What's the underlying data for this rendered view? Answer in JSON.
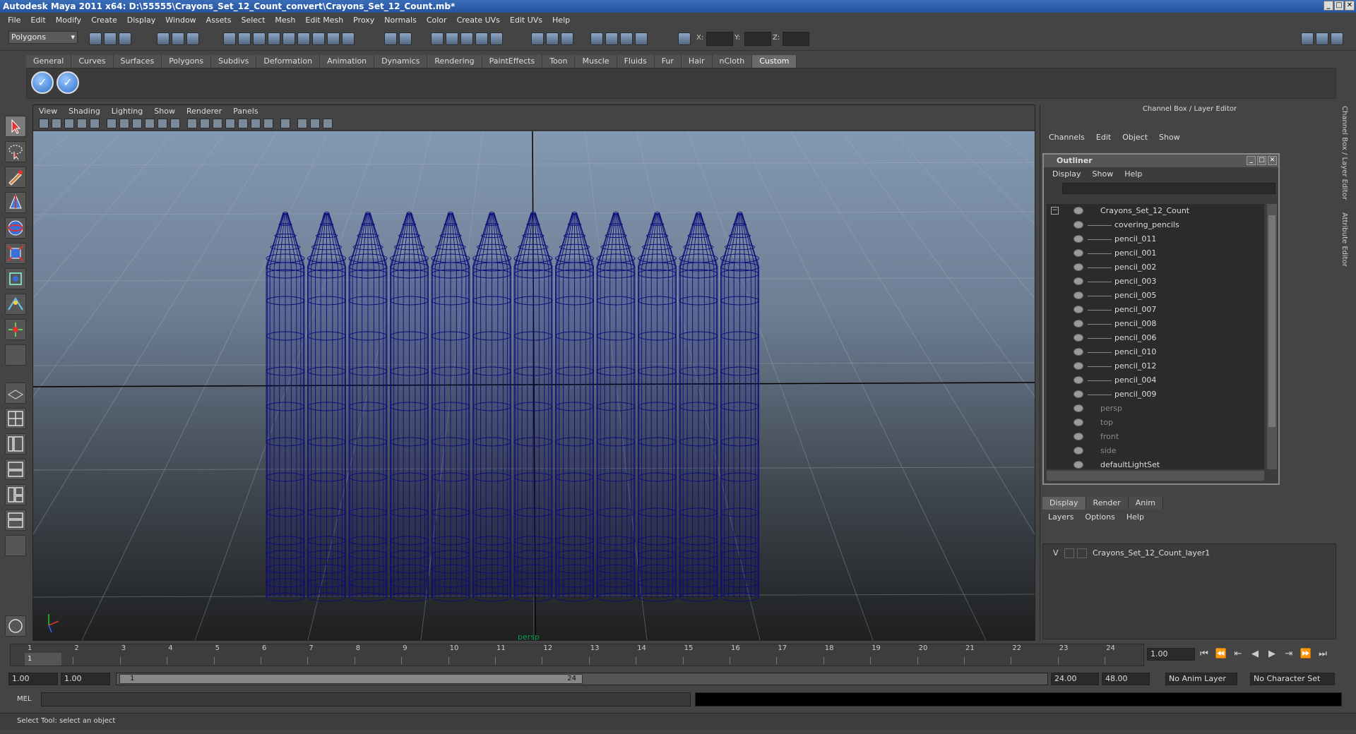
{
  "window": {
    "title": "Autodesk Maya 2011 x64: D:\\55555\\Crayons_Set_12_Count_convert\\Crayons_Set_12_Count.mb*"
  },
  "menubar": [
    "File",
    "Edit",
    "Modify",
    "Create",
    "Display",
    "Window",
    "Assets",
    "Select",
    "Mesh",
    "Edit Mesh",
    "Proxy",
    "Normals",
    "Color",
    "Create UVs",
    "Edit UVs",
    "Help"
  ],
  "statusline": {
    "mode": "Polygons",
    "x_label": "X:",
    "y_label": "Y:",
    "z_label": "Z:"
  },
  "shelf_tabs": [
    "General",
    "Curves",
    "Surfaces",
    "Polygons",
    "Subdivs",
    "Deformation",
    "Animation",
    "Dynamics",
    "Rendering",
    "PaintEffects",
    "Toon",
    "Muscle",
    "Fluids",
    "Fur",
    "Hair",
    "nCloth",
    "Custom"
  ],
  "shelf_active_tab": "Custom",
  "viewport": {
    "menu": [
      "View",
      "Shading",
      "Lighting",
      "Show",
      "Renderer",
      "Panels"
    ],
    "camera": "persp"
  },
  "channel_box": {
    "title": "Channel Box / Layer Editor",
    "menu": [
      "Channels",
      "Edit",
      "Object",
      "Show"
    ]
  },
  "outliner": {
    "title": "Outliner",
    "menu": [
      "Display",
      "Show",
      "Help"
    ],
    "root": "Crayons_Set_12_Count",
    "children": [
      "covering_pencils",
      "pencil_011",
      "pencil_001",
      "pencil_002",
      "pencil_003",
      "pencil_005",
      "pencil_007",
      "pencil_008",
      "pencil_006",
      "pencil_010",
      "pencil_012",
      "pencil_004",
      "pencil_009"
    ],
    "cameras": [
      "persp",
      "top",
      "front",
      "side"
    ],
    "sets": [
      "defaultLightSet"
    ]
  },
  "layer_editor": {
    "tabs": [
      "Display",
      "Render",
      "Anim"
    ],
    "active_tab": "Display",
    "menu": [
      "Layers",
      "Options",
      "Help"
    ],
    "layers": [
      {
        "visible": "V",
        "name": "Crayons_Set_12_Count_layer1"
      }
    ]
  },
  "time_slider": {
    "ticks": [
      "1",
      "2",
      "3",
      "4",
      "5",
      "6",
      "7",
      "8",
      "9",
      "10",
      "11",
      "12",
      "13",
      "14",
      "15",
      "16",
      "17",
      "18",
      "19",
      "20",
      "21",
      "22",
      "23",
      "24"
    ],
    "current_frame": "1.00",
    "current_marker": "1"
  },
  "range_slider": {
    "start": "1.00",
    "playback_start": "1.00",
    "range_min": "1",
    "range_max": "24",
    "playback_end": "24.00",
    "end": "48.00",
    "anim_layer": "No Anim Layer",
    "character_set": "No Character Set"
  },
  "command_line": {
    "label": "MEL"
  },
  "help_line": {
    "text": "Select Tool: select an object"
  },
  "side_tabs": [
    "Channel Box / Layer Editor",
    "Attribute Editor"
  ],
  "colors": {
    "wireframe": "#0c0c78",
    "viewport_top": "#8398b1",
    "viewport_bottom": "#1e1f20",
    "title_bar": "#2554a0"
  }
}
